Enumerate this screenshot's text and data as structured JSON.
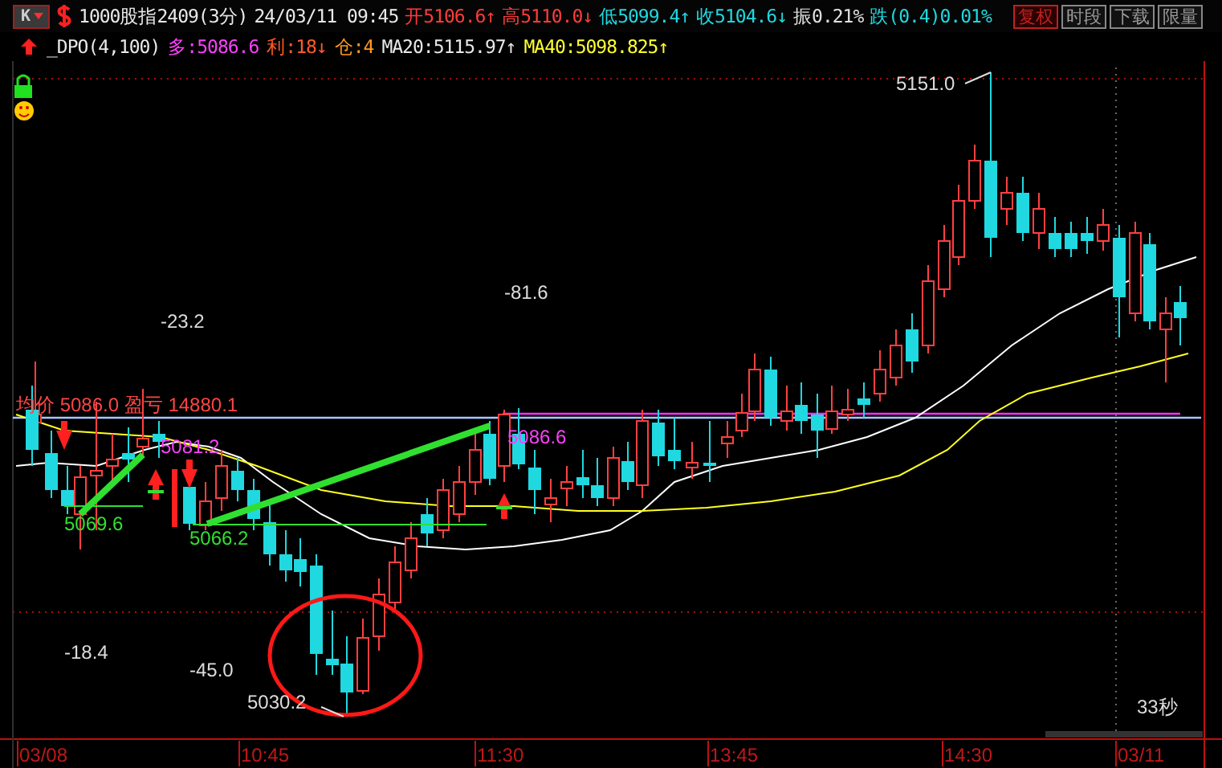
{
  "header": {
    "chart_type_button": "K",
    "symbol": "1000股指2409(3分)",
    "datetime": "24/03/11 09:45",
    "quotes": [
      {
        "text": "开5106.6↑",
        "kind": "rise"
      },
      {
        "text": "高5110.0↓",
        "kind": "rise"
      },
      {
        "text": "低5099.4↑",
        "kind": "fall"
      },
      {
        "text": "收5104.6↓",
        "kind": "fall"
      },
      {
        "text": "振0.21%",
        "kind": "plain"
      },
      {
        "text": "跌(0.4)0.01%",
        "kind": "fall"
      }
    ],
    "buttons": [
      {
        "label": "复权",
        "selected": true
      },
      {
        "label": "时段",
        "selected": false
      },
      {
        "label": "下载",
        "selected": false
      },
      {
        "label": "限量",
        "selected": false
      }
    ]
  },
  "indicators": [
    {
      "text": "_DPO(4,100)",
      "color": "#e8e8e8"
    },
    {
      "text": "多:5086.6",
      "color": "#ff40ff"
    },
    {
      "text": "利:18↓",
      "color": "#ff5a2a"
    },
    {
      "text": "仓:4",
      "color": "#ff9a20"
    },
    {
      "text": "MA20:5115.97↑",
      "color": "#e8e8e8"
    },
    {
      "text": "MA40:5098.825↑",
      "color": "#ffff30"
    }
  ],
  "chart_labels": [
    {
      "text": "5151.0",
      "kind": "extreme"
    },
    {
      "text": "-81.6",
      "kind": "value"
    },
    {
      "text": "-23.2",
      "kind": "value"
    },
    {
      "text": "-18.4",
      "kind": "value"
    },
    {
      "text": "-45.0",
      "kind": "value"
    },
    {
      "text": "5030.2",
      "kind": "extreme"
    },
    {
      "text": "均价 5086.0  盈亏 14880.1",
      "kind": "pnl"
    },
    {
      "text": "5081.2",
      "kind": "signal"
    },
    {
      "text": "5086.6",
      "kind": "signal"
    },
    {
      "text": "5069.6",
      "kind": "support"
    },
    {
      "text": "5066.2",
      "kind": "support"
    }
  ],
  "countdown": "33秒",
  "time_axis": [
    "03/08",
    "10:45",
    "11:30",
    "13:45",
    "14:30",
    "03/11"
  ]
}
